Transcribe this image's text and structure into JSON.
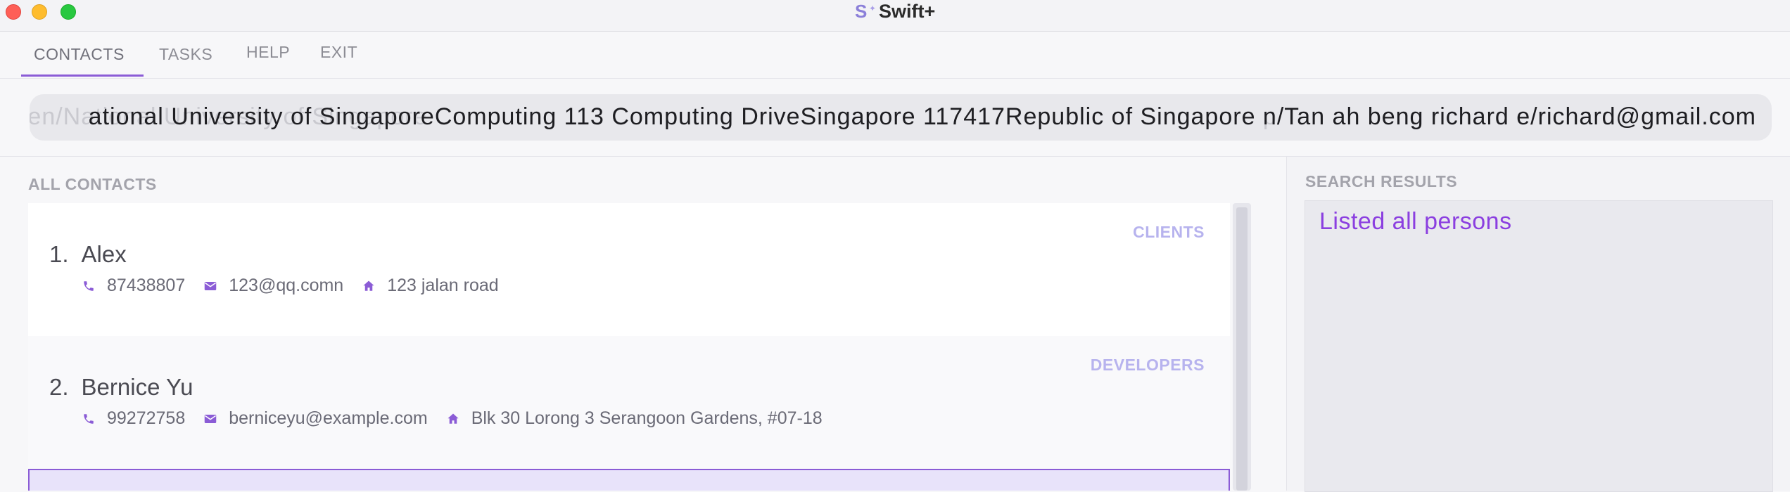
{
  "window": {
    "title": "Swift+"
  },
  "menu": {
    "items": [
      "CONTACTS",
      "TASKS",
      "HELP",
      "EXIT"
    ],
    "active": "CONTACTS"
  },
  "command": {
    "value": "ational University of SingaporeComputing 113 Computing DriveSingapore 117417Republic of Singapore n/Tan ah beng richard e/richard@gmail.com",
    "ghost": "addc n/ Cantuarden/National University of Singapore Computing 113 Computing DriveSingapore 117417Republic of Singapore p/Tan ah beng richard e/richard@gmail.com"
  },
  "contacts": {
    "title": "ALL CONTACTS",
    "items": [
      {
        "index": "1.",
        "name": "Alex",
        "tag": "CLIENTS",
        "phone": "87438807",
        "email": "123@qq.comn",
        "address": "123 jalan road"
      },
      {
        "index": "2.",
        "name": "Bernice Yu",
        "tag": "DEVELOPERS",
        "phone": "99272758",
        "email": "berniceyu@example.com",
        "address": "Blk 30 Lorong 3 Serangoon Gardens, #07-18"
      }
    ]
  },
  "results": {
    "title": "SEARCH RESULTS",
    "message": "Listed all persons"
  },
  "colors": {
    "accent": "#8b5cd6",
    "tag": "#b7b3ee",
    "result_text": "#8b3fe0"
  }
}
